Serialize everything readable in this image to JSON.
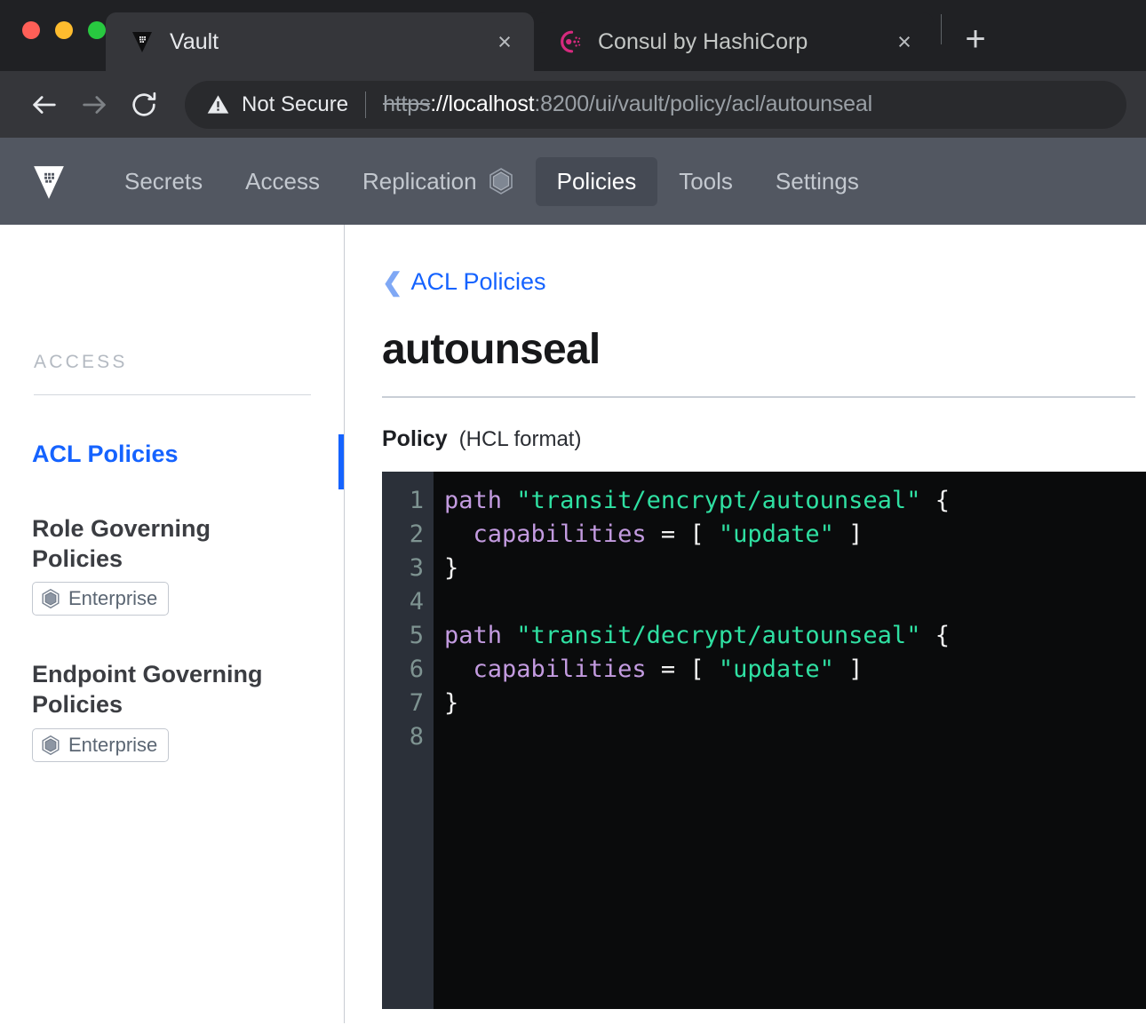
{
  "browser": {
    "tabs": [
      {
        "title": "Vault",
        "favicon": "vault-logo-icon",
        "active": true,
        "close_label": "×"
      },
      {
        "title": "Consul by HashiCorp",
        "favicon": "consul-logo-icon",
        "active": false,
        "close_label": "×"
      }
    ],
    "new_tab_label": "+",
    "toolbar": {
      "back_label": "back-arrow-icon",
      "forward_label": "forward-arrow-icon",
      "reload_label": "reload-icon",
      "security_text": "Not Secure",
      "url_scheme": "https",
      "url_host": "://localhost",
      "url_rest": ":8200/ui/vault/policy/acl/autounseal",
      "url_full": "https://localhost:8200/ui/vault/policy/acl/autounseal"
    }
  },
  "vault_nav": {
    "logo": "vault-logo-icon",
    "items": [
      {
        "label": "Secrets",
        "active": false,
        "badge": null
      },
      {
        "label": "Access",
        "active": false,
        "badge": null
      },
      {
        "label": "Replication",
        "active": false,
        "badge": "enterprise-hex-icon"
      },
      {
        "label": "Policies",
        "active": true,
        "badge": null
      },
      {
        "label": "Tools",
        "active": false,
        "badge": null
      },
      {
        "label": "Settings",
        "active": false,
        "badge": null
      }
    ]
  },
  "sidebar": {
    "heading": "ACCESS",
    "items": [
      {
        "label": "ACL Policies",
        "active": true,
        "badge": null
      },
      {
        "label": "Role Governing Policies",
        "active": false,
        "badge": "Enterprise"
      },
      {
        "label": "Endpoint Governing Policies",
        "active": false,
        "badge": "Enterprise"
      }
    ]
  },
  "main": {
    "breadcrumb": {
      "chevron": "❮",
      "label": "ACL Policies"
    },
    "title": "autounseal",
    "policy_label": "Policy",
    "policy_format": "(HCL format)",
    "editor": {
      "line_numbers": [
        "1",
        "2",
        "3",
        "4",
        "5",
        "6",
        "7",
        "8"
      ],
      "lines": [
        [
          {
            "t": "path",
            "c": "kw"
          },
          {
            "t": " ",
            "c": "pun"
          },
          {
            "t": "\"transit/encrypt/autounseal\"",
            "c": "str"
          },
          {
            "t": " {",
            "c": "pun"
          }
        ],
        [
          {
            "t": "  ",
            "c": "pun"
          },
          {
            "t": "capabilities",
            "c": "kw"
          },
          {
            "t": " = [ ",
            "c": "pun"
          },
          {
            "t": "\"update\"",
            "c": "str"
          },
          {
            "t": " ]",
            "c": "pun"
          }
        ],
        [
          {
            "t": "}",
            "c": "pun"
          }
        ],
        [
          {
            "t": "",
            "c": "pun"
          }
        ],
        [
          {
            "t": "path",
            "c": "kw"
          },
          {
            "t": " ",
            "c": "pun"
          },
          {
            "t": "\"transit/decrypt/autounseal\"",
            "c": "str"
          },
          {
            "t": " {",
            "c": "pun"
          }
        ],
        [
          {
            "t": "  ",
            "c": "pun"
          },
          {
            "t": "capabilities",
            "c": "kw"
          },
          {
            "t": " = [ ",
            "c": "pun"
          },
          {
            "t": "\"update\"",
            "c": "str"
          },
          {
            "t": " ]",
            "c": "pun"
          }
        ],
        [
          {
            "t": "}",
            "c": "pun"
          }
        ],
        [
          {
            "t": "",
            "c": "pun"
          }
        ]
      ],
      "plain_text": "path \"transit/encrypt/autounseal\" {\n  capabilities = [ \"update\" ]\n}\n\npath \"transit/decrypt/autounseal\" {\n  capabilities = [ \"update\" ]\n}\n"
    }
  },
  "colors": {
    "accent_blue": "#1563ff",
    "nav_bar": "#525761",
    "editor_bg": "#0a0b0c",
    "gutter_bg": "#2b3039",
    "syntax_keyword": "#c39be0",
    "syntax_string": "#2fe0a2",
    "consul_magenta": "#d62a7e"
  }
}
